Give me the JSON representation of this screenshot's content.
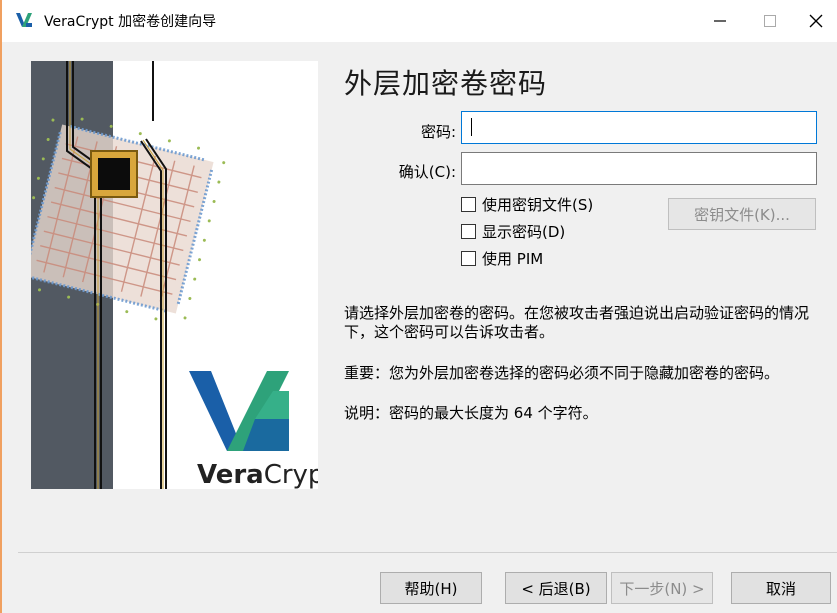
{
  "window": {
    "title": "VeraCrypt 加密卷创建向导",
    "minimize_glyph": "—",
    "maximize_glyph": "□",
    "close_glyph": "✕"
  },
  "side_image": {
    "brand_text_bold": "Vera",
    "brand_text_light": "Crypt"
  },
  "page": {
    "title": "外层加密卷密码",
    "password_label": "密码:",
    "password_value": "",
    "confirm_label": "确认(C):",
    "confirm_value": "",
    "checkboxes": [
      {
        "label": "使用密钥文件(S)",
        "checked": false
      },
      {
        "label": "显示密码(D)",
        "checked": false
      },
      {
        "label": "使用 PIM",
        "checked": false
      }
    ],
    "keyfiles_button": "密钥文件(K)...",
    "paragraph1": "请选择外层加密卷的密码。在您被攻击者强迫说出启动验证密码的情况下，这个密码可以告诉攻击者。",
    "paragraph2": "重要：您为外层加密卷选择的密码必须不同于隐藏加密卷的密码。",
    "paragraph3": "说明：密码的最大长度为 64 个字符。"
  },
  "footer": {
    "help": "帮助(H)",
    "back": "< 后退(B)",
    "next": "下一步(N) >",
    "cancel": "取消"
  },
  "colors": {
    "accent": "#0078d7",
    "brand_blue": "#1a5fa8",
    "brand_teal": "#2ea27a"
  }
}
